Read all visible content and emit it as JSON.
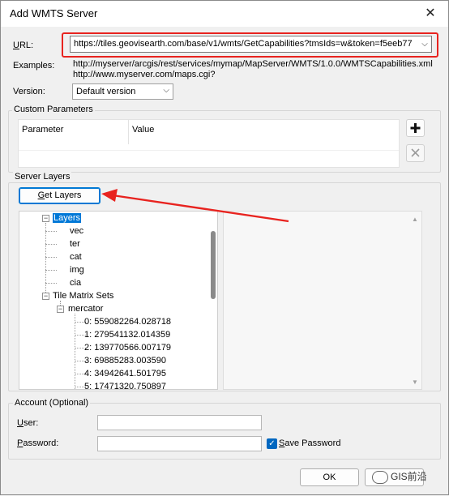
{
  "window": {
    "title": "Add WMTS Server"
  },
  "url": {
    "label_u": "U",
    "label_rest": "RL:",
    "value": "https://tiles.geovisearth.com/base/v1/wmts/GetCapabilities?tmsIds=w&token=f5eeb77"
  },
  "examples": {
    "label": "Examples:",
    "line1": "http://myserver/arcgis/rest/services/mymap/MapServer/WMTS/1.0.0/WMTSCapabilities.xml",
    "line2": "http://www.myserver.com/maps.cgi?"
  },
  "version": {
    "label": "Version:",
    "selected": "Default version"
  },
  "custom_params": {
    "title": "Custom Parameters",
    "col_parameter": "Parameter",
    "col_value": "Value"
  },
  "server_layers": {
    "title": "Server Layers",
    "get_layers_u": "G",
    "get_layers_rest": "et Layers",
    "tree": {
      "layers": "Layers",
      "layer_items": [
        "vec",
        "ter",
        "cat",
        "img",
        "cia"
      ],
      "tile_matrix_sets": "Tile Matrix Sets",
      "mercator": "mercator",
      "matrix_items": [
        "0: 559082264.028718",
        "1: 279541132.014359",
        "2: 139770566.007179",
        "3: 69885283.003590",
        "4: 34942641.501795",
        "5: 17471320.750897"
      ]
    }
  },
  "account": {
    "title": "Account (Optional)",
    "user_u": "U",
    "user_rest": "ser:",
    "password_u": "P",
    "password_rest": "assword:",
    "save_password_u": "S",
    "save_password_rest": "ave Password",
    "save_password_checked": true
  },
  "footer": {
    "ok_label": "OK",
    "watermark": "GIS前沿"
  },
  "colors": {
    "highlight_red": "#e8231f",
    "selection_blue": "#0078d7",
    "checkbox_blue": "#0067c0"
  }
}
